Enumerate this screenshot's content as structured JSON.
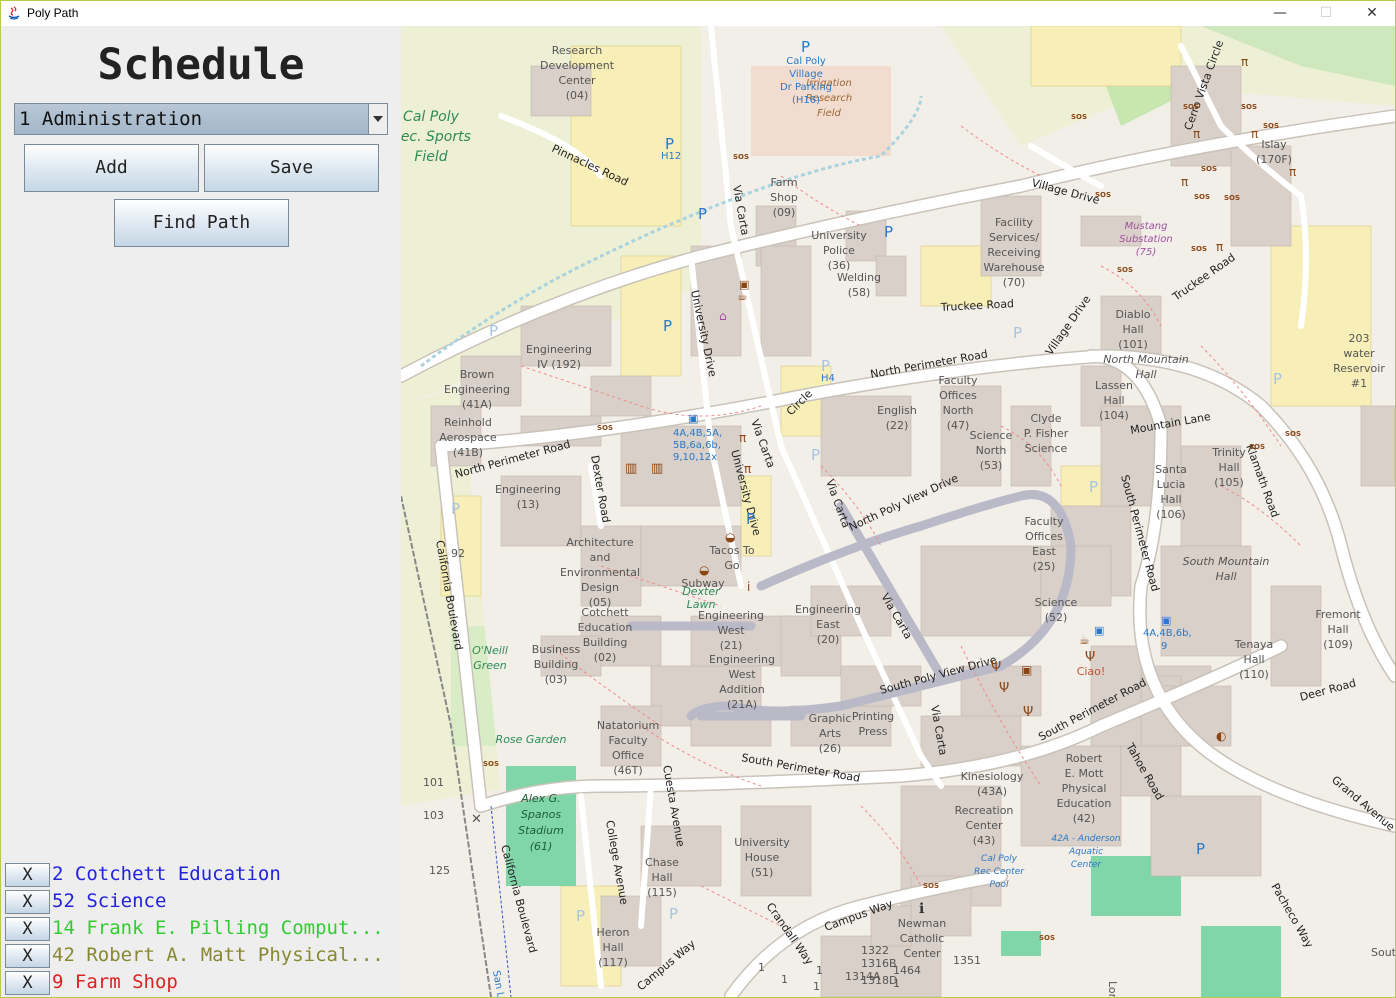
{
  "window": {
    "title": "Poly Path",
    "controls": {
      "minimize": "—",
      "maximize": "☐",
      "close": "✕"
    }
  },
  "schedule": {
    "heading": "Schedule",
    "selected_building": "1 Administration",
    "add_label": "Add",
    "save_label": "Save",
    "find_path_label": "Find Path",
    "remove_label": "X",
    "items": [
      {
        "label": "2 Cotchett Education",
        "color": "#2222dd"
      },
      {
        "label": "52 Science",
        "color": "#2222dd"
      },
      {
        "label": "14 Frank E. Pilling Comput...",
        "color": "#33cc33"
      },
      {
        "label": "42 Robert A. Matt Physical...",
        "color": "#888833"
      },
      {
        "label": "9 Farm Shop",
        "color": "#dd2222"
      }
    ]
  },
  "map": {
    "buildings": [
      {
        "name": "Research Development Center (04)"
      },
      {
        "name": "Cal Poly Village Dr Parking (H16)"
      },
      {
        "name": "Irrigation Research Field"
      },
      {
        "name": "Cal Poly Rec. Sports Field"
      },
      {
        "name": "Farm Shop (09)"
      },
      {
        "name": "University Police (36)"
      },
      {
        "name": "Welding (58)"
      },
      {
        "name": "Facility Services/Receiving Warehouse (70)"
      },
      {
        "name": "Mustang Substation (75)"
      },
      {
        "name": "Islay (170F)"
      },
      {
        "name": "Diablo Hall (101)"
      },
      {
        "name": "North Mountain Hall"
      },
      {
        "name": "Lassen Hall (104)"
      },
      {
        "name": "203 water Reservoir #1"
      },
      {
        "name": "Engineering IV (192)"
      },
      {
        "name": "Brown Engineering (41A)"
      },
      {
        "name": "Reinhold Aerospace (41B)"
      },
      {
        "name": "Faculty Offices North (47)"
      },
      {
        "name": "English (22)"
      },
      {
        "name": "Science North (53)"
      },
      {
        "name": "Clyde P. Fisher Science"
      },
      {
        "name": "Trinity Hall (105)"
      },
      {
        "name": "Santa Lucia Hall (106)"
      },
      {
        "name": "Engineering (13)"
      },
      {
        "name": "Architecture and Environmental Design (05)"
      },
      {
        "name": "Tacos To Go"
      },
      {
        "name": "Subway"
      },
      {
        "name": "Dexter Lawn"
      },
      {
        "name": "Faculty Offices East (25)"
      },
      {
        "name": "Science (52)"
      },
      {
        "name": "South Mountain Hall"
      },
      {
        "name": "Fremont Hall (109)"
      },
      {
        "name": "Tenaya Hall (110)"
      },
      {
        "name": "Cotchett Education Building (02)"
      },
      {
        "name": "Engineering West (21)"
      },
      {
        "name": "Engineering East (20)"
      },
      {
        "name": "Engineering West Addition (21A)"
      },
      {
        "name": "Business Building (03)"
      },
      {
        "name": "O'Neill Green"
      },
      {
        "name": "Rose Garden"
      },
      {
        "name": "Natatorium Faculty Office (46T)"
      },
      {
        "name": "Graphic Arts (26)"
      },
      {
        "name": "Printing Press"
      },
      {
        "name": "Ciao!"
      },
      {
        "name": "Robert E. Mott Physical Education (42)"
      },
      {
        "name": "Kinesiology (43A)"
      },
      {
        "name": "Recreation Center (43)"
      },
      {
        "name": "42A - Anderson Aquatic Center"
      },
      {
        "name": "Cal Poly Rec Center Pool"
      },
      {
        "name": "Alex G. Spanos Stadium (61)"
      },
      {
        "name": "University House (51)"
      },
      {
        "name": "Chase Hall (115)"
      },
      {
        "name": "Heron Hall (117)"
      },
      {
        "name": "Newman Catholic Center"
      }
    ],
    "roads": [
      "Pinnacles Road",
      "Via Carta",
      "Village Drive",
      "Cerro Vista Circle",
      "Truckee Road",
      "North Perimeter Road",
      "University Drive",
      "Circle",
      "Mountain Lane",
      "Dexter Road",
      "North Poly View Drive",
      "South Perimeter Road",
      "Klamath Road",
      "California Boulevard",
      "South Poly View Drive",
      "Deer Road",
      "Tahoe Road",
      "Grand Avenue",
      "Cuesta Avenue",
      "College Avenue",
      "Campus Way",
      "Crandall Way",
      "Pacheco Way"
    ],
    "transit_labels": [
      "4A,4B,5A,5B,6a,6b,9,10,12x",
      "4A,4B,6b,9"
    ],
    "parking_labels": [
      "H12",
      "H4"
    ]
  }
}
